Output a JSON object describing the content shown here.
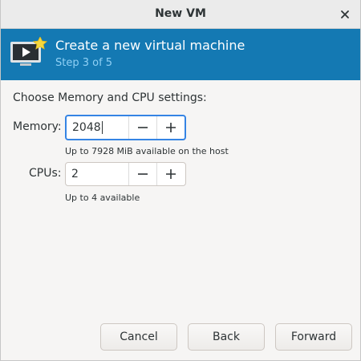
{
  "window": {
    "title": "New VM"
  },
  "banner": {
    "title": "Create a new virtual machine",
    "step": "Step 3 of 5"
  },
  "settings": {
    "heading": "Choose Memory and CPU settings:",
    "memory": {
      "label": "Memory:",
      "value": "2048",
      "hint": "Up to 7928 MiB available on the host"
    },
    "cpus": {
      "label": "CPUs:",
      "value": "2",
      "hint": "Up to 4 available"
    }
  },
  "buttons": {
    "cancel": "Cancel",
    "back": "Back",
    "forward": "Forward"
  },
  "icons": {
    "close": "close-icon",
    "banner": "vm-screen-icon",
    "decrement": "minus-icon",
    "increment": "plus-icon"
  },
  "colors": {
    "banner": "#1479b3",
    "step_text": "#8fd0f5",
    "focus": "#3584e4"
  }
}
